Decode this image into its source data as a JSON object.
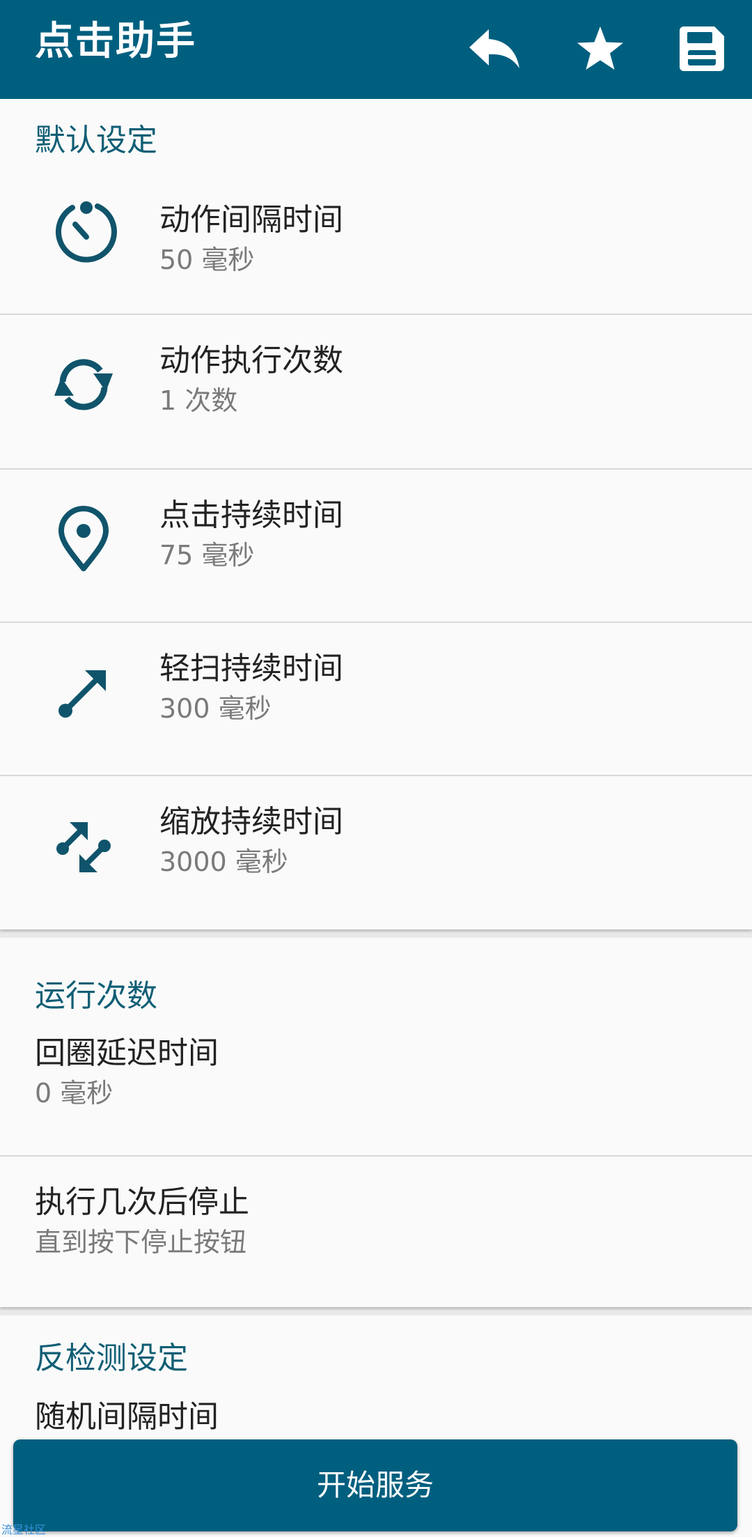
{
  "app_bar": {
    "title": "点击助手",
    "actions": [
      {
        "name": "reply-icon"
      },
      {
        "name": "star-icon"
      },
      {
        "name": "save-icon"
      }
    ]
  },
  "sections": {
    "default_settings": {
      "title": "默认设定",
      "items": [
        {
          "icon": "timer-icon",
          "title": "动作间隔时间",
          "summary": "50 毫秒"
        },
        {
          "icon": "repeat-icon",
          "title": "动作执行次数",
          "summary": "1 次数"
        },
        {
          "icon": "location-pin-icon",
          "title": "点击持续时间",
          "summary": "75 毫秒"
        },
        {
          "icon": "swipe-arrow-icon",
          "title": "轻扫持续时间",
          "summary": "300 毫秒"
        },
        {
          "icon": "pinch-zoom-icon",
          "title": "缩放持续时间",
          "summary": "3000 毫秒"
        }
      ]
    },
    "run_count": {
      "title": "运行次数",
      "items": [
        {
          "title": "回圈延迟时间",
          "summary": "0 毫秒"
        },
        {
          "title": "执行几次后停止",
          "summary": "直到按下停止按钮"
        }
      ]
    },
    "anti_detection": {
      "title": "反检测设定",
      "items": [
        {
          "title": "随机间隔时间"
        }
      ]
    }
  },
  "start_button": {
    "label": "开始服务"
  },
  "watermark": "流星社区",
  "colors": {
    "primary": "#005f7f",
    "section_title": "#115e75",
    "icon": "#10546b",
    "background": "#fafafa",
    "summary_text": "#7a7a7a"
  }
}
